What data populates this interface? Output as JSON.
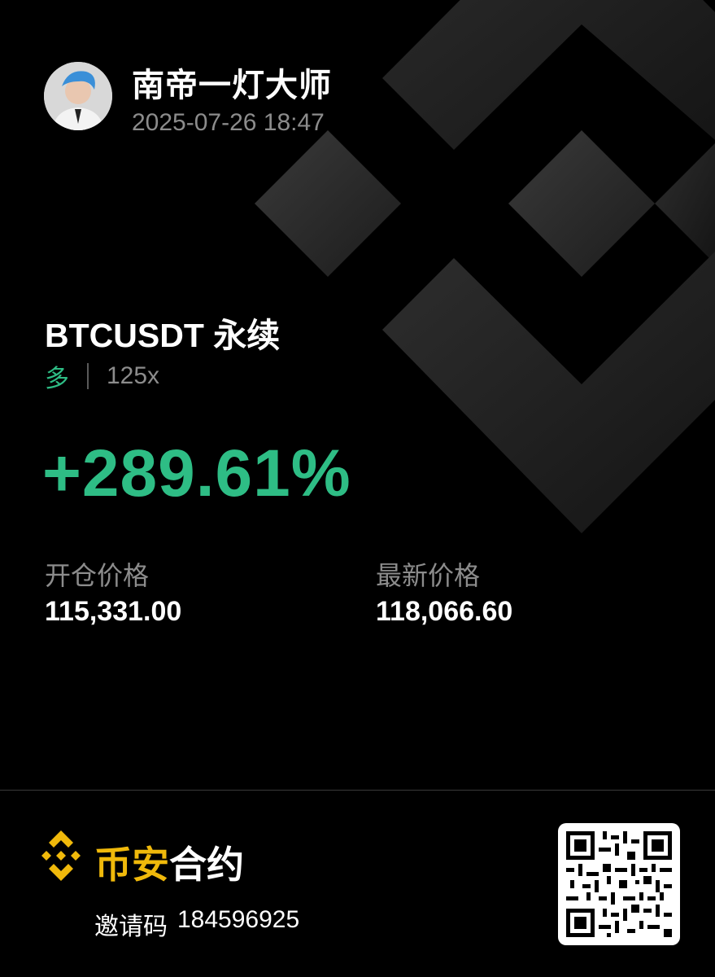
{
  "user": {
    "name": "南帝一灯大师",
    "timestamp": "2025-07-26 18:47"
  },
  "position": {
    "symbol": "BTCUSDT 永续",
    "side": "多",
    "leverage": "125x",
    "pnl_percent": "+289.61%",
    "entry_price_label": "开仓价格",
    "entry_price": "115,331.00",
    "mark_price_label": "最新价格",
    "mark_price": "118,066.60"
  },
  "footer": {
    "brand_part1": "币安",
    "brand_part2": "合约",
    "invite_label": "邀请码",
    "invite_code": "184596925"
  },
  "colors": {
    "profit": "#2ebd85",
    "brand": "#f0b90b",
    "muted": "#8c8c8c",
    "background": "#000000"
  },
  "icons": [
    "binance-background-logo",
    "binance-logo-icon",
    "avatar",
    "qr-code"
  ]
}
